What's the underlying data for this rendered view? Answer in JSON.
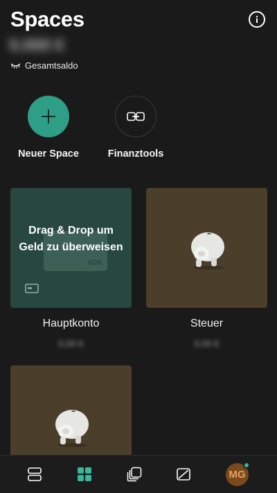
{
  "header": {
    "title": "Spaces",
    "balance_hidden": "5.000 €",
    "balance_label": "Gesamtsaldo",
    "icons": {
      "info": "info-icon",
      "eye": "eye-closed-icon"
    }
  },
  "actions": [
    {
      "label": "Neuer Space",
      "icon": "plus-icon"
    },
    {
      "label": "Finanztools",
      "icon": "link-icon"
    }
  ],
  "spaces": [
    {
      "name": "Hauptkonto",
      "balance_hidden": "0,00 €",
      "overlay_text": "Drag & Drop um Geld zu überweisen",
      "card_text": "N26",
      "color": "#27473f"
    },
    {
      "name": "Steuer",
      "balance_hidden": "0,00 €",
      "color": "#4b3e2b",
      "icon": "piggy-bank-icon"
    },
    {
      "name": "",
      "color": "#4b3e2b",
      "icon": "piggy-bank-icon"
    }
  ],
  "bottom_nav": {
    "items": [
      "accounts-icon",
      "spaces-grid-icon",
      "cards-stack-icon",
      "card-off-icon"
    ],
    "active": "spaces-grid-icon",
    "avatar_initials": "MG",
    "accent": "#37b89a"
  }
}
